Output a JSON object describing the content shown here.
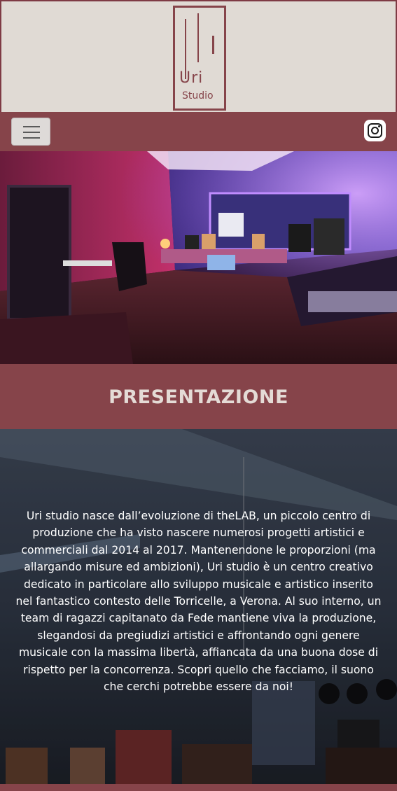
{
  "header": {
    "logo": {
      "main": "Uri",
      "sub": "Studio"
    }
  },
  "navbar": {
    "menu_icon": "hamburger-menu-icon",
    "social_icon": "instagram-icon"
  },
  "hero": {
    "image": "recording-studio-photo"
  },
  "presentation": {
    "title": "PRESENTAZIONE",
    "body": "Uri studio nasce dall’evoluzione di theLAB, un piccolo centro di produzione che ha visto nascere numerosi progetti artistici e commerciali dal 2014 al 2017. Mantenendone le proporzioni (ma allargando misure ed ambizioni), Uri studio è un centro creativo dedicato in particolare allo sviluppo musicale e artistico inserito nel fantastico contesto delle Torricelle, a Verona. Al suo interno, un team di ragazzi capitanato da Fede mantiene viva la produzione, slegandosi da pregiudizi artistici e affrontando ogni genere musicale con la massima libertà, affiancata da una buona dose di rispetto per la concorrenza. Scopri quello che facciamo, il suono che cerchi potrebbe essere da noi!"
  },
  "colors": {
    "brand": "#86444a",
    "header_bg": "#e0dad4",
    "title_text": "#e4dbd6"
  }
}
